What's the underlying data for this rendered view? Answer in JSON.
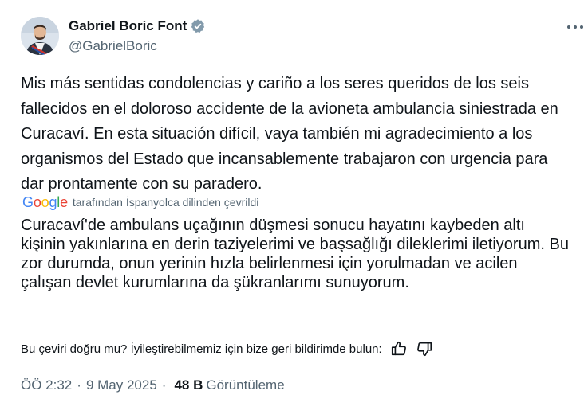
{
  "author": {
    "display_name": "Gabriel Boric Font",
    "handle": "@GabrielBoric",
    "verified": true,
    "verified_icon": "verified-badge-icon",
    "verified_color": "#829aab"
  },
  "tweet": {
    "text": "Mis más sentidas condolencias y cariño a los seres queridos de los seis fallecidos en el doloroso accidente de la avioneta ambulancia siniestrada en Curacaví. En esta situación difícil, vaya también mi agradecimiento a los organismos del Estado que incansablemente trabajaron con urgencia para dar prontamente con su paradero.",
    "translation_provider": "Google",
    "translation_note": "tarafından İspanyolca dilinden çevrildi",
    "translated_text": "Curacaví'de ambulans uçağının düşmesi sonucu hayatını kaybeden altı kişinin yakınlarına en derin taziyelerimi ve başsağlığı dileklerimi iletiyorum. Bu zor durumda, onun yerinin hızla belirlenmesi için yorulmadan ve acilen çalışan devlet kurumlarına da şükranlarımı sunuyorum.",
    "feedback_question": "Bu çeviri doğru mu? İyileştirebilmemiz için bize geri bildirimde bulun:"
  },
  "meta": {
    "time": "ÖÖ 2:32",
    "separator": "·",
    "date": "9 May 2025",
    "views_count": "48 B",
    "views_label": "Görüntüleme"
  },
  "colors": {
    "text_primary": "#0f1419",
    "text_secondary": "#536471",
    "google_blue": "#4285F4",
    "google_red": "#EA4335",
    "google_yellow": "#FBBC05",
    "google_green": "#34A853"
  },
  "icons": {
    "more": "more-horizontal-icon",
    "thumbs_up": "thumbs-up-icon",
    "thumbs_down": "thumbs-down-icon"
  }
}
